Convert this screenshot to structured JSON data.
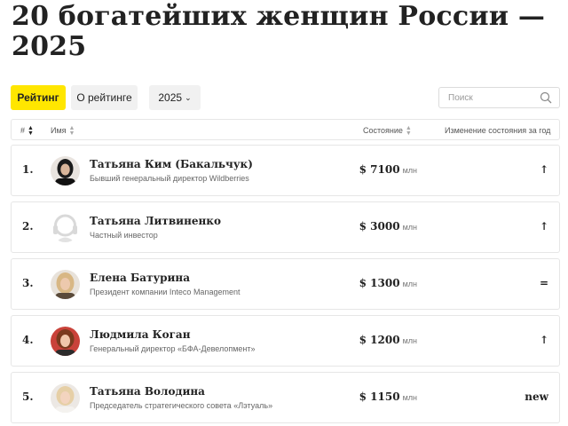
{
  "page": {
    "title": "20 богатейших женщин России — 2025"
  },
  "controls": {
    "rating_label": "Рейтинг",
    "about_label": "О рейтинге",
    "year_label": "2025",
    "search_placeholder": "Поиск"
  },
  "table": {
    "headers": {
      "num": "#",
      "name": "Имя",
      "wealth": "Состояние",
      "change": "Изменение состояния за год"
    },
    "rows": [
      {
        "rank": "1.",
        "name": "Татьяна Ким (Бакальчук)",
        "position": "Бывший генеральный директор Wildberries",
        "wealth": "$ 7100",
        "unit": "млн",
        "change": "↑",
        "avatar_icon": "person-photo-icon"
      },
      {
        "rank": "2.",
        "name": "Татьяна Литвиненко",
        "position": "Частный инвестор",
        "wealth": "$ 3000",
        "unit": "млн",
        "change": "↑",
        "avatar_icon": "placeholder-avatar-icon"
      },
      {
        "rank": "3.",
        "name": "Елена Батурина",
        "position": "Президент компании Inteco Management",
        "wealth": "$ 1300",
        "unit": "млн",
        "change": "=",
        "avatar_icon": "person-photo-icon"
      },
      {
        "rank": "4.",
        "name": "Людмила Коган",
        "position": "Генеральный директор «БФА-Девелопмент»",
        "wealth": "$ 1200",
        "unit": "млн",
        "change": "↑",
        "avatar_icon": "person-photo-icon"
      },
      {
        "rank": "5.",
        "name": "Татьяна Володина",
        "position": "Председатель стратегического совета «Лэтуаль»",
        "wealth": "$ 1150",
        "unit": "млн",
        "change": "new",
        "avatar_icon": "person-photo-icon"
      }
    ]
  },
  "colors": {
    "accent": "#ffe600",
    "button_bg": "#f1f1f1",
    "border": "#e6e6e6"
  }
}
